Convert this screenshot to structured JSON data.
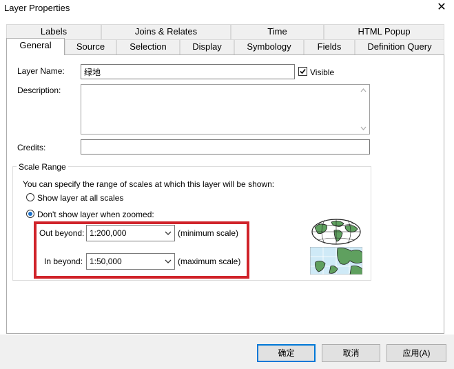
{
  "window": {
    "title": "Layer Properties",
    "close_glyph": "✕"
  },
  "tabs_row1": [
    {
      "label": "Labels"
    },
    {
      "label": "Joins & Relates"
    },
    {
      "label": "Time"
    },
    {
      "label": "HTML Popup"
    }
  ],
  "tabs_row2": [
    {
      "label": "General",
      "active": true
    },
    {
      "label": "Source"
    },
    {
      "label": "Selection"
    },
    {
      "label": "Display"
    },
    {
      "label": "Symbology"
    },
    {
      "label": "Fields"
    },
    {
      "label": "Definition Query"
    }
  ],
  "general": {
    "layer_name_label": "Layer Name:",
    "layer_name_value": "绿地",
    "visible_label": "Visible",
    "visible_checked": true,
    "description_label": "Description:",
    "description_value": "",
    "credits_label": "Credits:",
    "credits_value": ""
  },
  "scale_range": {
    "group_title": "Scale Range",
    "intro": "You can specify the range of scales at which this layer will be shown:",
    "option_all": "Show layer at all scales",
    "option_zoomed": "Don't show layer when zoomed:",
    "selected_option": "zoomed",
    "out_beyond_label": "Out beyond:",
    "out_beyond_value": "1:200,000",
    "out_beyond_hint": "(minimum scale)",
    "in_beyond_label": "In beyond:",
    "in_beyond_value": "1:50,000",
    "in_beyond_hint": "(maximum scale)",
    "highlight_color": "#d0232a"
  },
  "footer": {
    "ok_label": "确定",
    "cancel_label": "取消",
    "apply_label": "应用(A)"
  },
  "icons": [
    "close-icon",
    "checkbox-checked-icon",
    "globe-icon",
    "map-zoomed-icon",
    "chevron-down-icon",
    "scroll-up-icon",
    "scroll-down-icon"
  ]
}
